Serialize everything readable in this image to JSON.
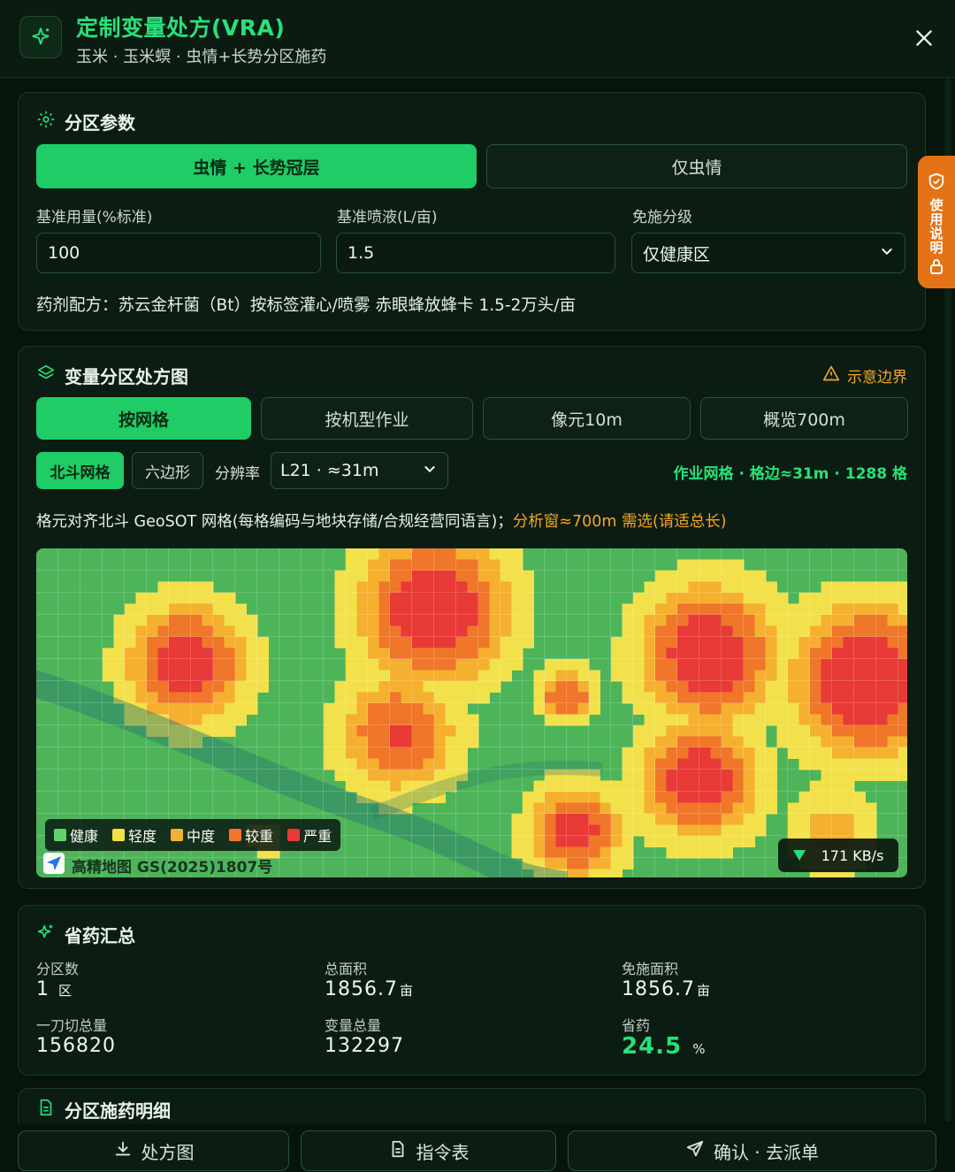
{
  "header": {
    "title": "定制变量处方(VRA)",
    "subtitle": "玉米 · 玉米螟 · 虫情+长势分区施药"
  },
  "params": {
    "title": "分区参数",
    "mode_tabs": [
      "虫情 + 长势冠层",
      "仅虫情"
    ],
    "base_dose_label": "基准用量(%标准)",
    "base_dose_value": "100",
    "base_spray_label": "基准喷液(L/亩)",
    "base_spray_value": "1.5",
    "exempt_label": "免施分级",
    "exempt_value": "仅健康区",
    "formula": "药剂配方：苏云金杆菌（Bt）按标签灌心/喷雾  赤眼蜂放蜂卡 1.5-2万头/亩"
  },
  "zonemap": {
    "title": "变量分区处方图",
    "boundary_note": "示意边界",
    "view_tabs": [
      "按网格",
      "按机型作业",
      "像元10m",
      "概览700m"
    ],
    "grid_types": [
      "北斗网格",
      "六边形"
    ],
    "resolution_label": "分辨率",
    "resolution_value": "L21 · ≈31m",
    "grid_stats": "作业网格 · 格边≈31m · 1288 格",
    "note_main": "格元对齐北斗 GeoSOT 网格(每格编码与地块存储/合规经营同语言)；",
    "note_warn": "分析窗≈700m 需选(请适总长)",
    "legend": [
      {
        "label": "健康",
        "color": "#5dd36c"
      },
      {
        "label": "轻度",
        "color": "#f2e14a"
      },
      {
        "label": "中度",
        "color": "#f6b030"
      },
      {
        "label": "较重",
        "color": "#f0762a"
      },
      {
        "label": "严重",
        "color": "#e83a36"
      }
    ],
    "attribution": "高精地图 GS(2025)1807号",
    "speed": "171 KB/s"
  },
  "summary": {
    "title": "省药汇总",
    "items": [
      {
        "label": "分区数",
        "value": "1",
        "unit": "区"
      },
      {
        "label": "总面积",
        "value": "1856.7",
        "unit": "亩"
      },
      {
        "label": "免施面积",
        "value": "1856.7",
        "unit": "亩"
      },
      {
        "label": "一刀切总量",
        "value": "156820",
        "unit": ""
      },
      {
        "label": "变量总量",
        "value": "132297",
        "unit": ""
      },
      {
        "label": "省药",
        "value": "24.5",
        "unit": "%"
      }
    ]
  },
  "details": {
    "title": "分区施药明细"
  },
  "side_tab": {
    "label": "使用说明"
  },
  "bottom_actions": [
    "处方图",
    "指令表",
    "确认 · 去派单"
  ],
  "colors": {
    "accent": "#1fcc66",
    "warn": "#f5a623",
    "bg": "#06140c"
  }
}
